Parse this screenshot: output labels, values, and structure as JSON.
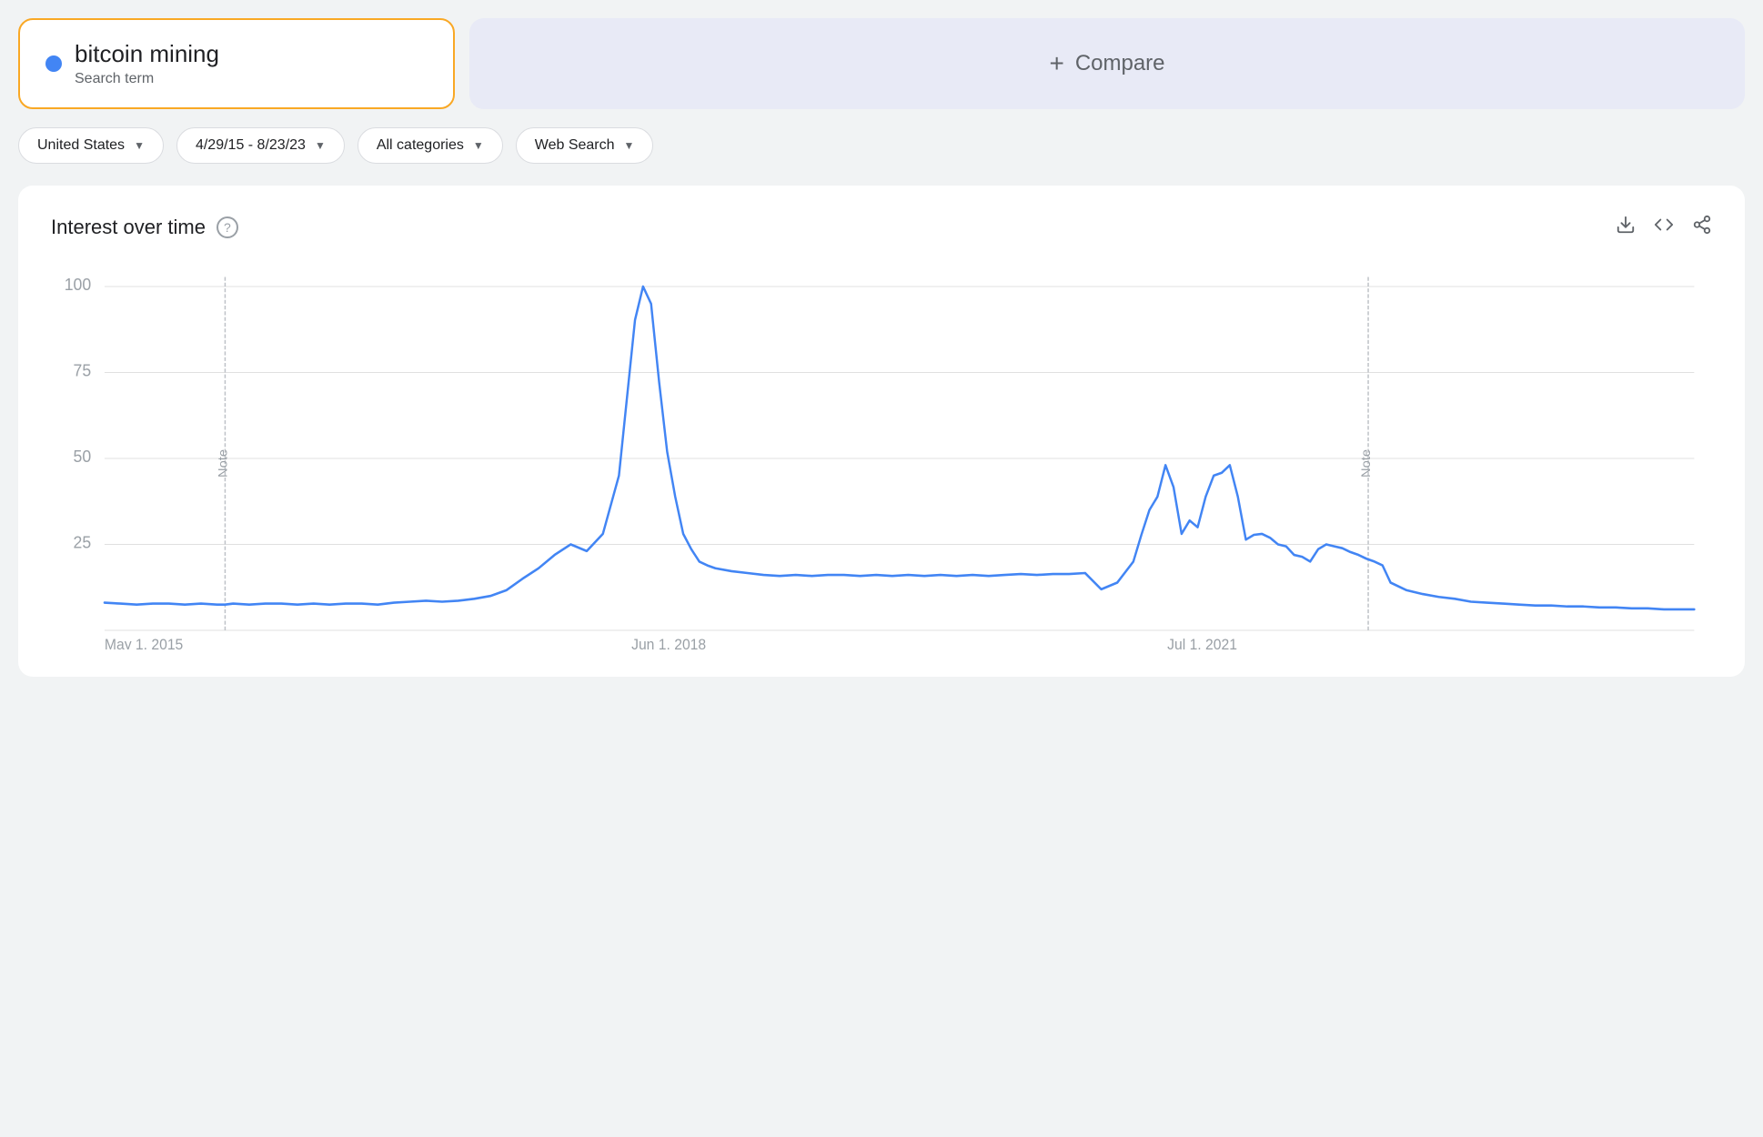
{
  "search_term": {
    "name": "bitcoin mining",
    "label": "Search term",
    "dot_color": "#4285f4"
  },
  "compare": {
    "label": "Compare",
    "plus": "+"
  },
  "filters": {
    "region": {
      "label": "United States",
      "has_dropdown": true
    },
    "date_range": {
      "label": "4/29/15 - 8/23/23",
      "has_dropdown": true
    },
    "category": {
      "label": "All categories",
      "has_dropdown": true
    },
    "search_type": {
      "label": "Web Search",
      "has_dropdown": true
    }
  },
  "chart": {
    "title": "Interest over time",
    "help_tooltip": "?",
    "y_labels": [
      "100",
      "75",
      "50",
      "25"
    ],
    "x_labels": [
      "May 1, 2015",
      "Jun 1, 2018",
      "Jul 1, 2021"
    ],
    "download_icon": "⬇",
    "embed_icon": "<>",
    "share_icon": "⊲"
  }
}
